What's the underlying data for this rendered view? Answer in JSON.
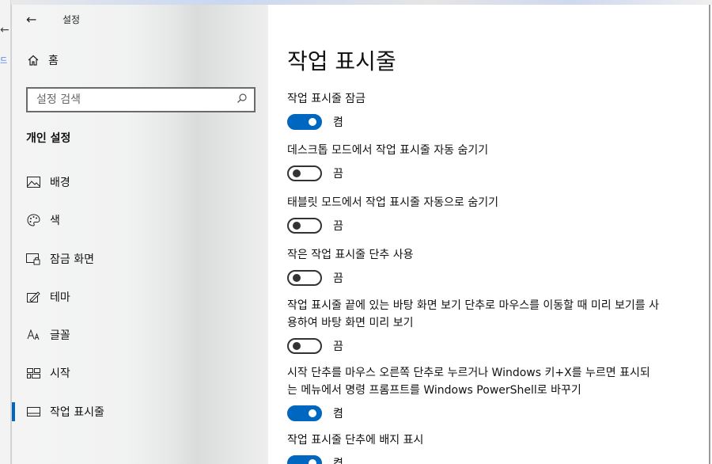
{
  "window": {
    "title": "설정",
    "back_glyph": "←"
  },
  "sidebar": {
    "home_label": "홈",
    "search_placeholder": "설정 검색",
    "section_title": "개인 설정",
    "items": [
      {
        "label": "배경",
        "icon": "picture-icon"
      },
      {
        "label": "색",
        "icon": "palette-icon"
      },
      {
        "label": "잠금 화면",
        "icon": "lock-screen-icon"
      },
      {
        "label": "테마",
        "icon": "theme-icon"
      },
      {
        "label": "글꼴",
        "icon": "font-icon"
      },
      {
        "label": "시작",
        "icon": "start-icon"
      },
      {
        "label": "작업 표시줄",
        "icon": "taskbar-icon",
        "selected": true
      }
    ]
  },
  "main": {
    "title": "작업 표시줄",
    "settings": [
      {
        "label": "작업 표시줄 잠금",
        "state": "켬",
        "on": true
      },
      {
        "label": "데스크톱 모드에서 작업 표시줄 자동 숨기기",
        "state": "끔",
        "on": false
      },
      {
        "label": "태블릿 모드에서 작업 표시줄 자동으로 숨기기",
        "state": "끔",
        "on": false
      },
      {
        "label": "작은 작업 표시줄 단추 사용",
        "state": "끔",
        "on": false
      },
      {
        "label": "작업 표시줄 끝에 있는 바탕 화면 보기 단추로 마우스를 이동할 때 미리 보기를 사용하여 바탕 화면 미리 보기",
        "state": "끔",
        "on": false
      },
      {
        "label": "시작 단추를 마우스 오른쪽 단추로 누르거나 Windows 키+X를 누르면 표시되는 메뉴에서 명령 프롬프트를 Windows PowerShell로 바꾸기",
        "state": "켬",
        "on": true
      },
      {
        "label": "작업 표시줄 단추에 배지 표시",
        "state": "켬",
        "on": true
      }
    ]
  },
  "browser": {
    "tab_text": "드"
  },
  "colors": {
    "accent": "#0067c0"
  }
}
